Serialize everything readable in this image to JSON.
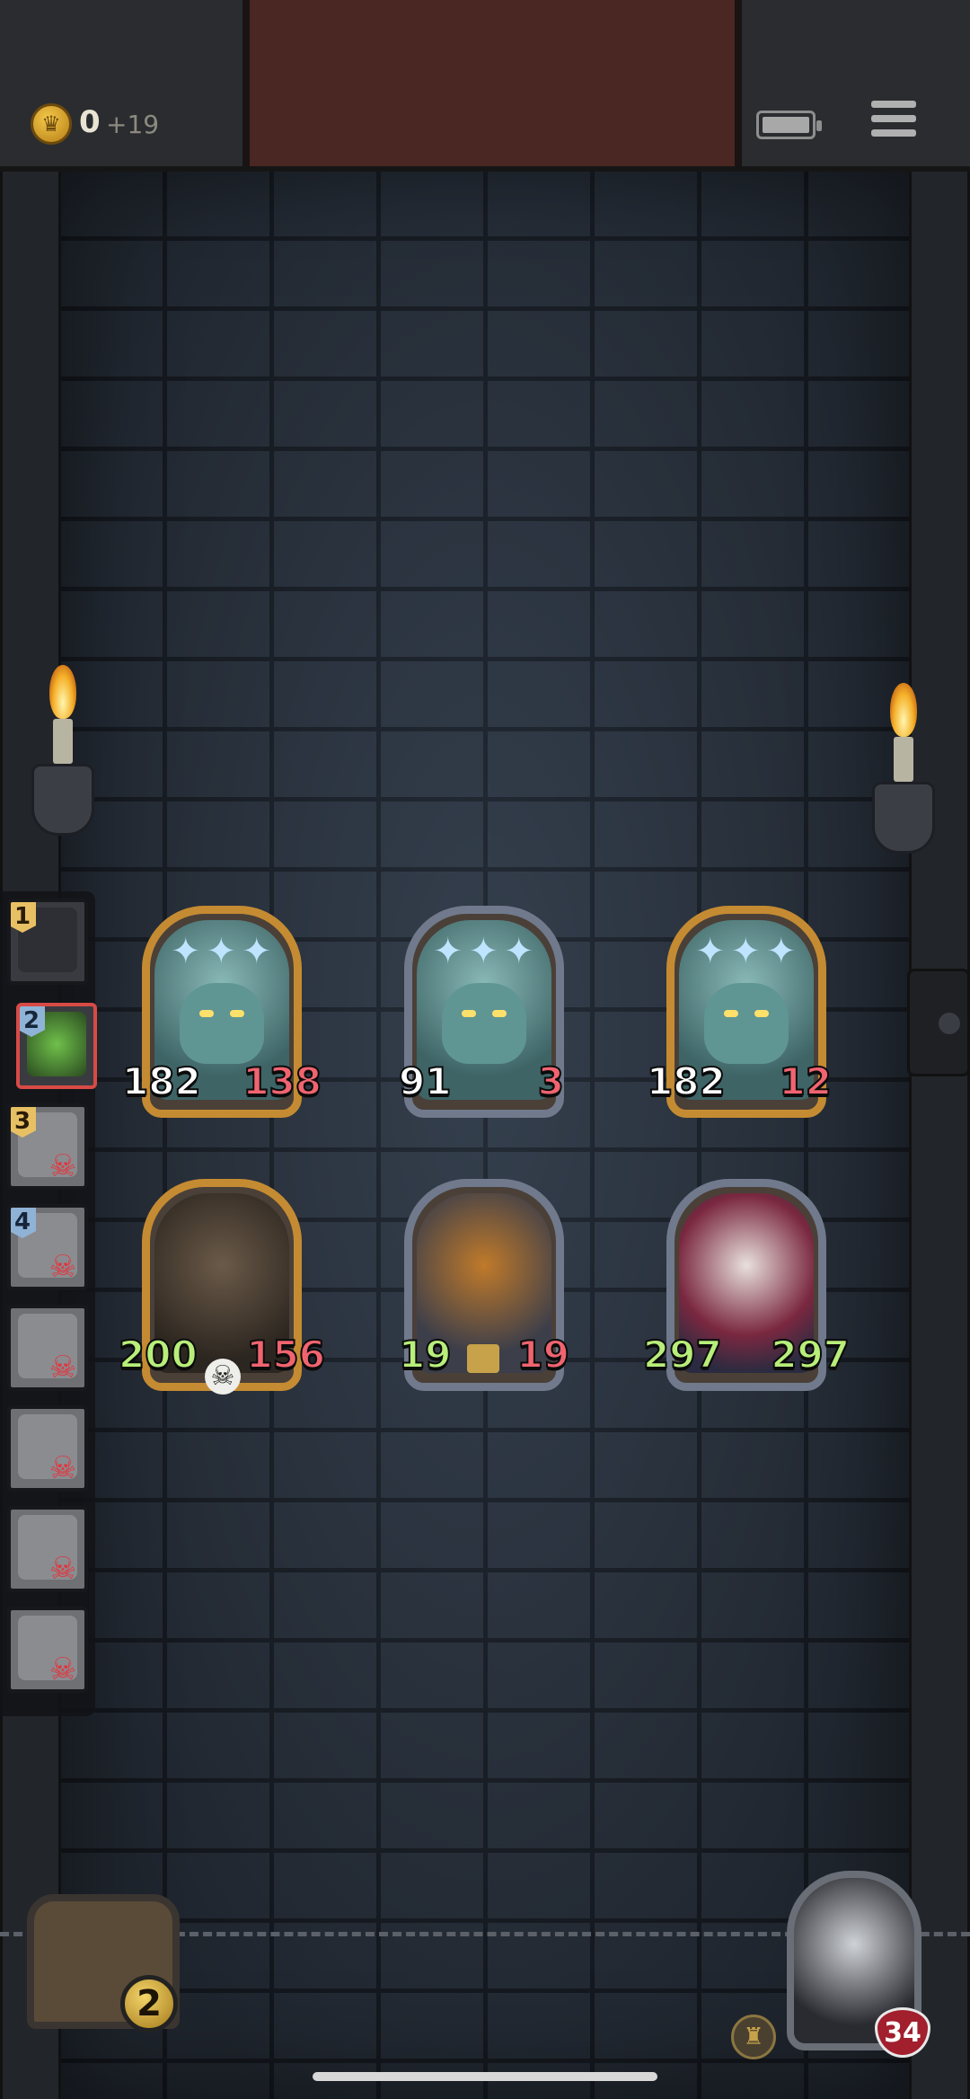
{
  "status": {
    "coins": "0",
    "coin_gain": "+19",
    "coin_icon": "crown-coin-icon",
    "battery_icon": "battery-icon",
    "menu_icon": "hamburger-menu-icon"
  },
  "turn_queue": [
    {
      "order": "1",
      "unit": "hooded-hero",
      "state": "alive"
    },
    {
      "order": "2",
      "unit": "goblin",
      "state": "active"
    },
    {
      "order": "3",
      "unit": "rat",
      "state": "dead"
    },
    {
      "order": "4",
      "unit": "knight",
      "state": "dead"
    },
    {
      "order": "",
      "unit": "wizard",
      "state": "dead"
    },
    {
      "order": "",
      "unit": "golem",
      "state": "dead"
    },
    {
      "order": "",
      "unit": "beast",
      "state": "dead"
    },
    {
      "order": "",
      "unit": "helmet",
      "state": "dead"
    }
  ],
  "enemies_row1": [
    {
      "name": "ghost-beast",
      "frame": "gold",
      "attack": "182",
      "health": "138"
    },
    {
      "name": "ghost-beast",
      "frame": "silver",
      "attack": "91",
      "health": "3"
    },
    {
      "name": "ghost-beast",
      "frame": "gold",
      "attack": "182",
      "health": "12"
    }
  ],
  "enemies_row2": [
    {
      "name": "mimic-chest",
      "frame": "gold",
      "attack": "200",
      "health": "156"
    },
    {
      "name": "pumpkin-knight",
      "frame": "silver",
      "attack": "19",
      "health": "19"
    },
    {
      "name": "jester-clown",
      "frame": "silver",
      "attack": "297",
      "health": "297"
    }
  ],
  "inventory": {
    "chest_count": "2"
  },
  "hero": {
    "health": "34"
  },
  "colors": {
    "gold_frame": "#c58b32",
    "silver_frame": "#707a8c",
    "hp_red": "#f06470",
    "buff_green": "#b8ee7a"
  }
}
